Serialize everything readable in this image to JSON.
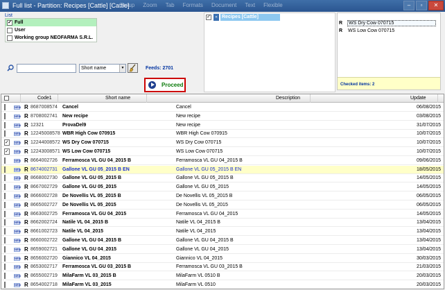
{
  "window": {
    "title": "Full list - Partition: Recipes  [Cattle]   [Cattle]",
    "menu": [
      "Group",
      "Zoom",
      "Tab",
      "Formats",
      "Document",
      "Text",
      "Flexible"
    ]
  },
  "list_group": {
    "legend": "List",
    "options": [
      {
        "label": "Full",
        "checked": true,
        "selected": true
      },
      {
        "label": "User",
        "checked": false,
        "selected": false
      },
      {
        "label": "Working group NEOFARMA S.R.L.",
        "checked": false,
        "selected": false
      }
    ]
  },
  "recipes_panel": {
    "label": "Recipes  [Cattle]",
    "arrow": "«"
  },
  "checked_panel": {
    "items": [
      {
        "r": "R",
        "text": "WS Dry Cow 070715"
      },
      {
        "r": "R",
        "text": "WS Low Cow 070715"
      }
    ],
    "footer": "Checked items: 2"
  },
  "search": {
    "value": "",
    "select_value": "Short name",
    "feeds": "Feeds: 2701"
  },
  "proceed": {
    "label": "Proceed"
  },
  "grid": {
    "columns": {
      "code": "Code1",
      "short": "Short name",
      "desc": "Description",
      "update": "Update"
    },
    "rows": [
      {
        "checked": false,
        "code": "8687008574",
        "short": "Cancel",
        "desc": "Cancel",
        "date": "06/08/2015"
      },
      {
        "checked": false,
        "code": "8708002741",
        "short": "New recipe",
        "desc": "New recipe",
        "date": "03/08/2015"
      },
      {
        "checked": false,
        "code": "12321",
        "short": "ProvaDel9",
        "desc": "New recipe",
        "date": "31/07/2015"
      },
      {
        "checked": false,
        "code": "12245008578",
        "short": "WBR High Cow 070915",
        "desc": "WBR High Cow 070915",
        "date": "10/07/2015"
      },
      {
        "checked": true,
        "code": "12244008572",
        "short": "WS Dry Cow 070715",
        "desc": "WS Dry Cow 070715",
        "date": "10/07/2015"
      },
      {
        "checked": true,
        "code": "12243008571",
        "short": "WS Low Cow 070715",
        "desc": "WS Low Cow 070715",
        "date": "10/07/2015"
      },
      {
        "checked": false,
        "code": "8664002726",
        "short": "Ferramosca VL GU 04_2015 B",
        "desc": "Ferramosca VL GU 04_2015 B",
        "date": "09/06/2015"
      },
      {
        "checked": false,
        "code": "8674002731",
        "short": "Gallone VL GU 05_2015 B EN",
        "desc": "Gallone VL GU 05_2015 B EN",
        "date": "18/05/2015",
        "selected": true
      },
      {
        "checked": false,
        "code": "8668002730",
        "short": "Gallone VL GU 05_2015 B",
        "desc": "Gallone VL GU 05_2015 B",
        "date": "14/05/2015"
      },
      {
        "checked": false,
        "code": "8667002729",
        "short": "Gallone VL GU 05_2015",
        "desc": "Gallone VL GU 05_2015",
        "date": "14/05/2015"
      },
      {
        "checked": false,
        "code": "8666002728",
        "short": "De Novellis VL 05_2015 B",
        "desc": "De Novellis VL 05_2015 B",
        "date": "06/05/2015"
      },
      {
        "checked": false,
        "code": "8665002727",
        "short": "De Novellis VL 05_2015",
        "desc": "De Novellis VL 05_2015",
        "date": "06/05/2015"
      },
      {
        "checked": false,
        "code": "8663002725",
        "short": "Ferramosca VL GU 04_2015",
        "desc": "Ferramosca VL GU 04_2015",
        "date": "14/05/2015"
      },
      {
        "checked": false,
        "code": "8662002724",
        "short": "Natile VL 04_2015 B",
        "desc": "Natile VL 04_2015 B",
        "date": "13/04/2015"
      },
      {
        "checked": false,
        "code": "8661002723",
        "short": "Natile VL 04_2015",
        "desc": "Natile VL 04_2015",
        "date": "13/04/2015"
      },
      {
        "checked": false,
        "code": "8660002722",
        "short": "Gallone VL GU 04_2015 B",
        "desc": "Gallone VL GU 04_2015 B",
        "date": "13/04/2015"
      },
      {
        "checked": false,
        "code": "8659002721",
        "short": "Gallone VL GU 04_2015",
        "desc": "Gallone VL GU 04_2015",
        "date": "13/04/2015"
      },
      {
        "checked": false,
        "code": "8656002720",
        "short": "Giannico VL 04_2015",
        "desc": "Giannico VL 04_2015",
        "date": "30/03/2015"
      },
      {
        "checked": false,
        "code": "8653002717",
        "short": "Ferramosca VL GU 03_2015 B",
        "desc": "Ferramosca VL GU 03_2015 B",
        "date": "21/03/2015"
      },
      {
        "checked": false,
        "code": "8655002719",
        "short": "MilaFarm VL 03_2015 B",
        "desc": "MilaFarm VL 0510 B",
        "date": "20/03/2015"
      },
      {
        "checked": false,
        "code": "8654002718",
        "short": "MilaFarm VL 03_2015",
        "desc": "MilaFarm VL 0510",
        "date": "20/03/2015"
      }
    ]
  }
}
